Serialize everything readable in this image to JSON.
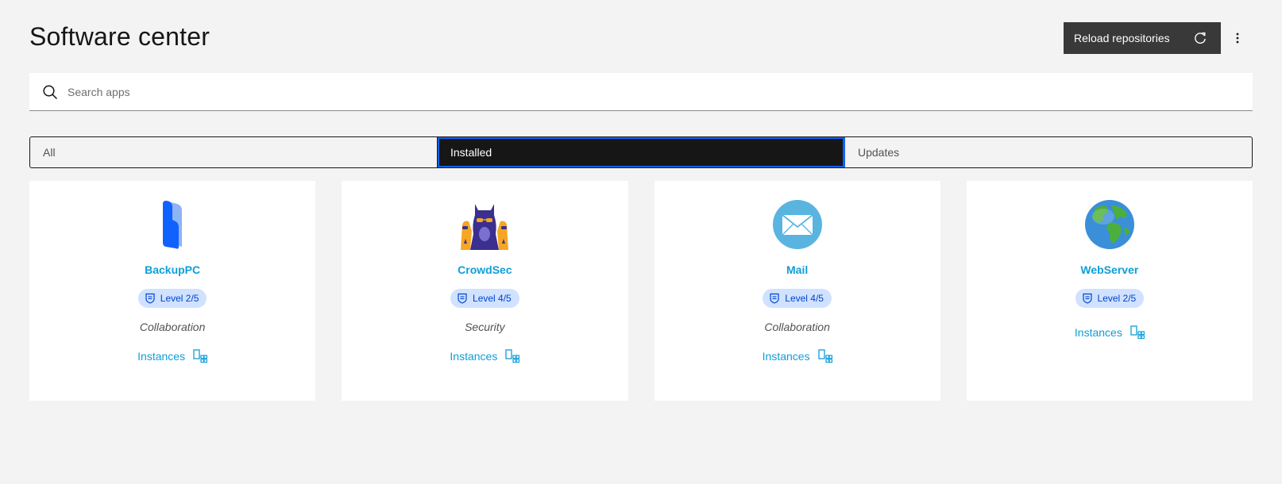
{
  "header": {
    "title": "Software center",
    "reload_label": "Reload repositories"
  },
  "search": {
    "placeholder": "Search apps",
    "value": ""
  },
  "tabs": [
    {
      "label": "All",
      "active": false
    },
    {
      "label": "Installed",
      "active": true
    },
    {
      "label": "Updates",
      "active": false
    }
  ],
  "apps": [
    {
      "name": "BackupPC",
      "level": "Level 2/5",
      "category": "Collaboration",
      "instances_label": "Instances",
      "logo": "backuppc-logo"
    },
    {
      "name": "CrowdSec",
      "level": "Level 4/5",
      "category": "Security",
      "instances_label": "Instances",
      "logo": "crowdsec-logo"
    },
    {
      "name": "Mail",
      "level": "Level 4/5",
      "category": "Collaboration",
      "instances_label": "Instances",
      "logo": "mail-logo"
    },
    {
      "name": "WebServer",
      "level": "Level 2/5",
      "category": "",
      "instances_label": "Instances",
      "logo": "globe-logo"
    }
  ],
  "colors": {
    "accent": "#0f9ed8",
    "badge_bg": "#d0e2ff",
    "button_bg": "#393939",
    "active_tab_bg": "#161616",
    "focus": "#0f62fe"
  }
}
